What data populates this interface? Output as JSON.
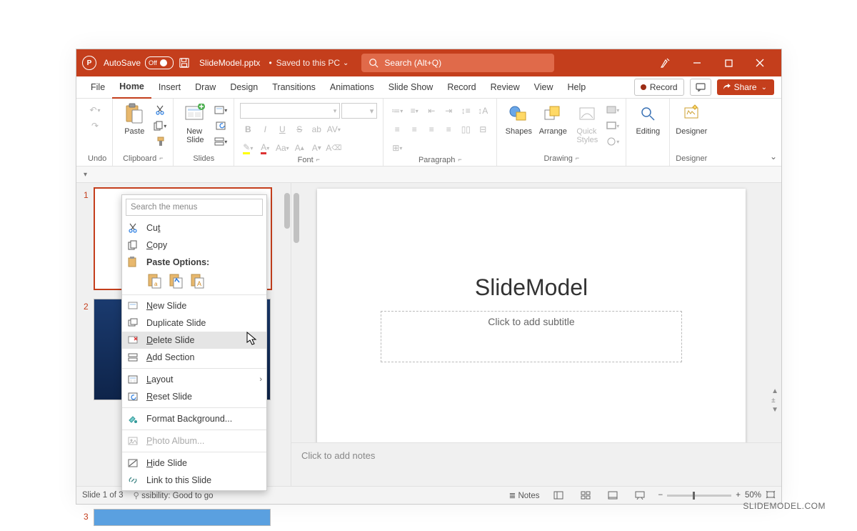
{
  "titlebar": {
    "autosave_label": "AutoSave",
    "autosave_state": "Off",
    "filename": "SlideModel.pptx",
    "saved_text": "Saved to this PC",
    "search_placeholder": "Search (Alt+Q)"
  },
  "tabs": {
    "file": "File",
    "home": "Home",
    "insert": "Insert",
    "draw": "Draw",
    "design": "Design",
    "transitions": "Transitions",
    "animations": "Animations",
    "slideshow": "Slide Show",
    "record": "Record",
    "review": "Review",
    "view": "View",
    "help": "Help",
    "record_btn": "Record",
    "share_btn": "Share"
  },
  "ribbon": {
    "undo": "Undo",
    "clipboard": "Clipboard",
    "paste": "Paste",
    "slides": "Slides",
    "new_slide": "New\nSlide",
    "font": "Font",
    "paragraph": "Paragraph",
    "drawing": "Drawing",
    "shapes": "Shapes",
    "arrange": "Arrange",
    "quick_styles": "Quick\nStyles",
    "editing": "Editing",
    "designer_grp": "Designer",
    "designer_btn": "Designer"
  },
  "context": {
    "search": "Search the menus",
    "cut": "Cut",
    "copy": "Copy",
    "paste_options": "Paste Options:",
    "new_slide": "New Slide",
    "duplicate": "Duplicate Slide",
    "delete": "Delete Slide",
    "add_section": "Add Section",
    "layout": "Layout",
    "reset": "Reset Slide",
    "format_bg": "Format Background...",
    "photo": "Photo Album...",
    "hide": "Hide Slide",
    "link": "Link to this Slide"
  },
  "slide": {
    "title": "SlideModel",
    "subtitle_placeholder": "Click to add subtitle"
  },
  "notes_placeholder": "Click to add notes",
  "status": {
    "slide_of": "Slide 1 of 3",
    "accessibility": "ssibility: Good to go",
    "notes_btn": "Notes",
    "zoom_pct": "50%"
  },
  "thumbs": [
    1,
    2,
    3
  ],
  "watermark": "SLIDEMODEL.COM"
}
